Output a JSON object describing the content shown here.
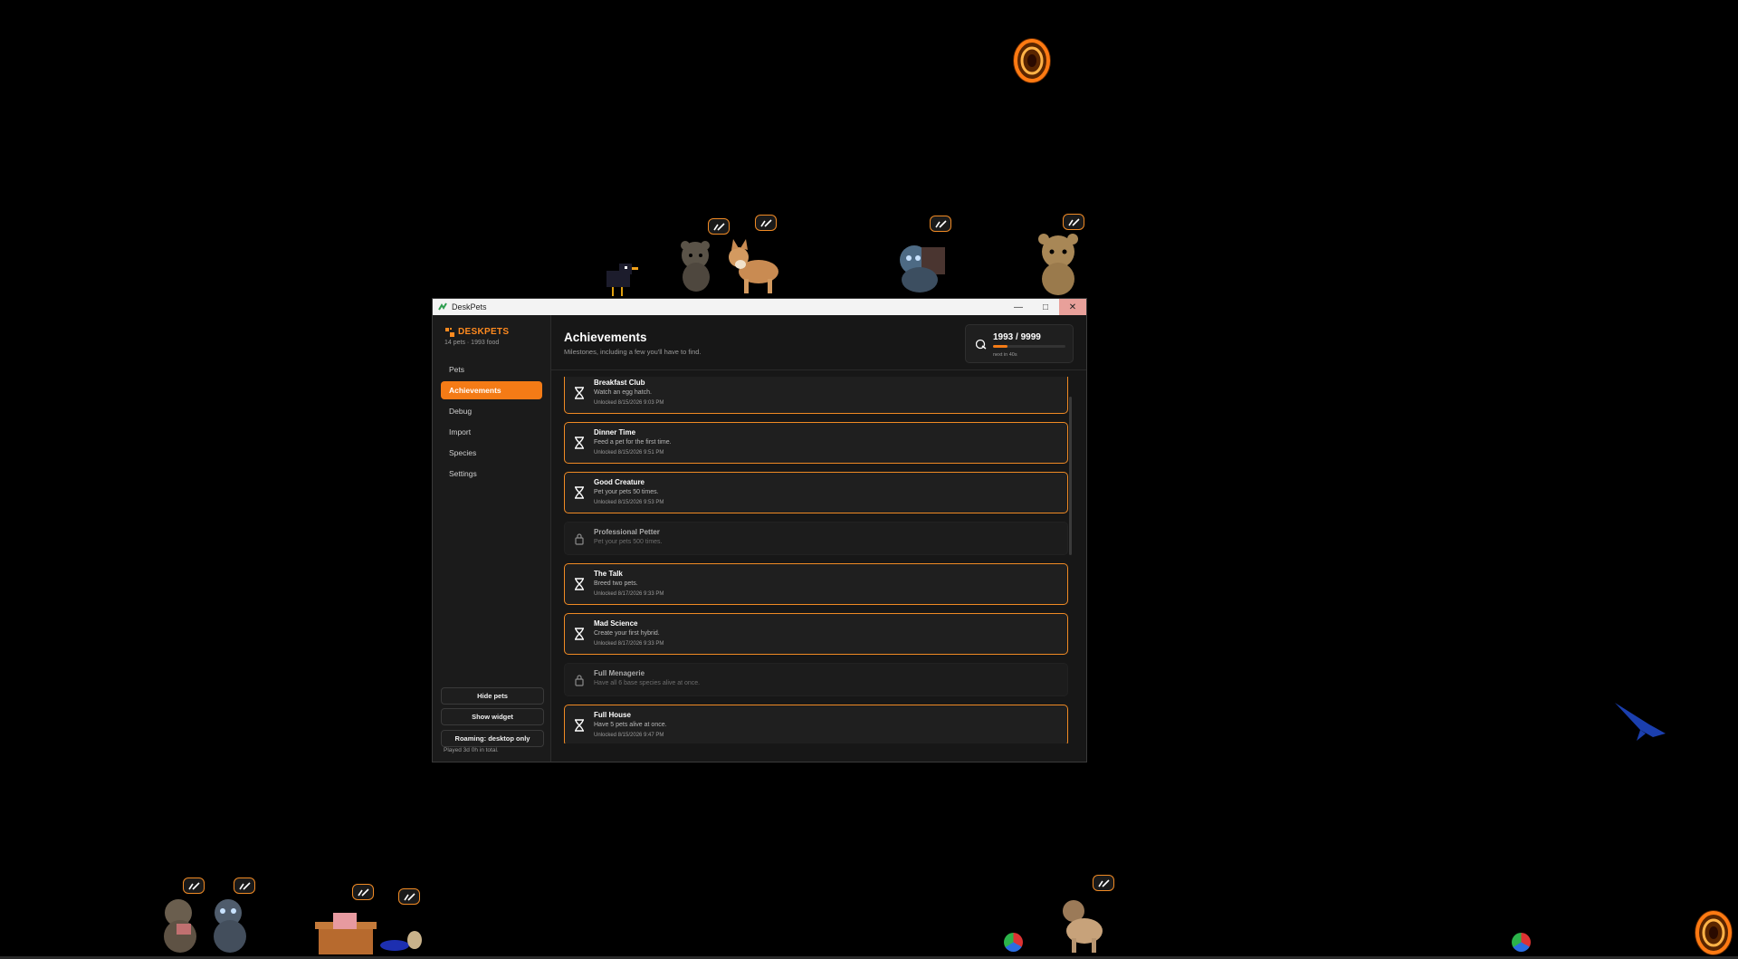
{
  "window": {
    "title": "DeskPets"
  },
  "brand": {
    "name": "DESKPETS",
    "subtitle": "14 pets · 1993 food"
  },
  "nav": {
    "items": [
      {
        "label": "Pets",
        "active": false
      },
      {
        "label": "Achievements",
        "active": true
      },
      {
        "label": "Debug",
        "active": false
      },
      {
        "label": "Import",
        "active": false
      },
      {
        "label": "Species",
        "active": false
      },
      {
        "label": "Settings",
        "active": false
      }
    ]
  },
  "sidebar_buttons": {
    "hide_pets": "Hide pets",
    "show_widget": "Show widget",
    "roaming": "Roaming: desktop only"
  },
  "played": "Played 3d 0h in total.",
  "page": {
    "title": "Achievements",
    "subtitle": "Milestones, including a few you'll have to find."
  },
  "food": {
    "count": "1993 / 9999",
    "next": "next in 40s",
    "fraction": 0.2
  },
  "achievements": [
    {
      "name": "Breakfast Club",
      "desc": "Watch an egg hatch.",
      "when": "Unlocked 8/15/2026 9:03 PM",
      "unlocked": true
    },
    {
      "name": "Dinner Time",
      "desc": "Feed a pet for the first time.",
      "when": "Unlocked 8/15/2026 9:51 PM",
      "unlocked": true
    },
    {
      "name": "Good Creature",
      "desc": "Pet your pets 50 times.",
      "when": "Unlocked 8/15/2026 9:53 PM",
      "unlocked": true
    },
    {
      "name": "Professional Petter",
      "desc": "Pet your pets 500 times.",
      "when": "",
      "unlocked": false
    },
    {
      "name": "The Talk",
      "desc": "Breed two pets.",
      "when": "Unlocked 8/17/2026 9:33 PM",
      "unlocked": true
    },
    {
      "name": "Mad Science",
      "desc": "Create your first hybrid.",
      "when": "Unlocked 8/17/2026 9:33 PM",
      "unlocked": true
    },
    {
      "name": "Full Menagerie",
      "desc": "Have all 6 base species alive at once.",
      "when": "",
      "unlocked": false
    },
    {
      "name": "Full House",
      "desc": "Have 5 pets alive at once.",
      "when": "Unlocked 8/15/2026 9:47 PM",
      "unlocked": true
    }
  ],
  "colors": {
    "accent": "#f47b16",
    "background": "#000000",
    "panel": "#171717"
  }
}
